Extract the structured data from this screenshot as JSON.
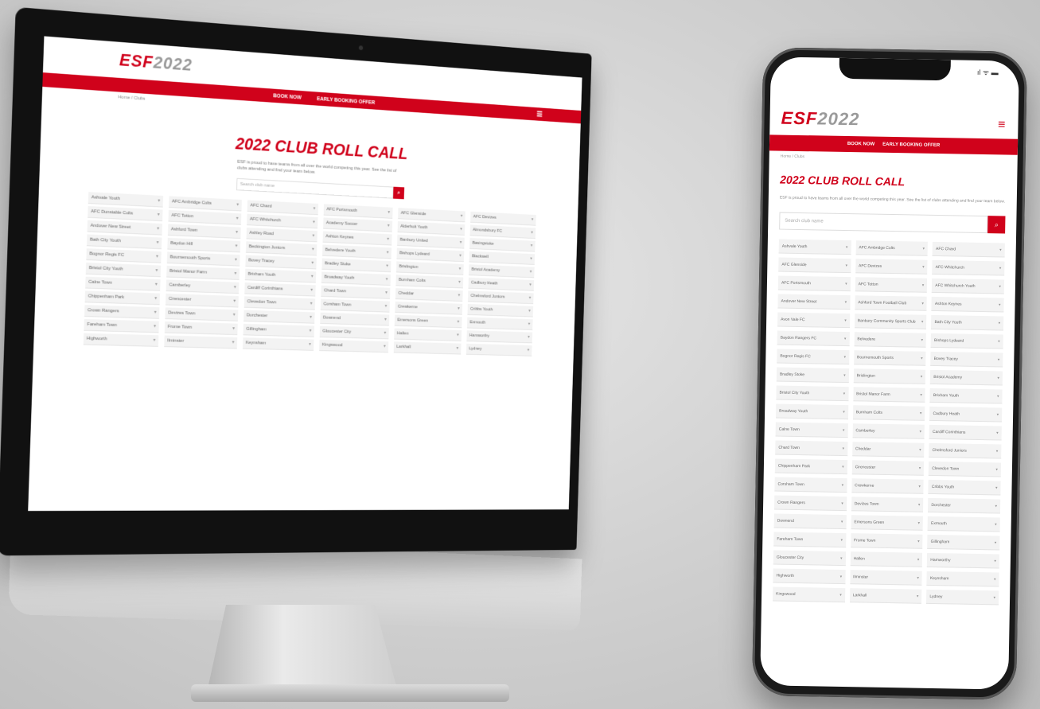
{
  "site": {
    "logo_left": "ESF",
    "logo_right": "2022",
    "nav": [
      "BOOK NOW",
      "EARLY BOOKING OFFER"
    ],
    "breadcrumb": "Home / Clubs",
    "title": "2022 CLUB ROLL CALL",
    "intro": "ESF is proud to have teams from all over the world competing this year. See the list of clubs attending and find your team below.",
    "search_placeholder": "Search club name",
    "menu_icon": "hamburger-icon",
    "search_icon": "search-icon"
  },
  "status_bar": "ıl ᯤ ▬",
  "clubs": [
    "Ashvale Youth",
    "AFC Ambridge Colts",
    "AFC Chard",
    "AFC Portsmouth",
    "AFC Glenside",
    "AFC Devizes",
    "AFC Dunstable Colts",
    "AFC Totton",
    "AFC Whitchurch",
    "Academy Soccer",
    "Alderholt Youth",
    "Almondsbury FC",
    "Andover New Street",
    "Ashford Town",
    "Ashley Road",
    "Ashton Keynes",
    "Banbury United",
    "Basingstoke",
    "Bath City Youth",
    "Baydon Hill",
    "Beckington Juniors",
    "Belvedere Youth",
    "Bishops Lydeard",
    "Blackwell",
    "Bognor Regis FC",
    "Bournemouth Sports",
    "Bovey Tracey",
    "Bradley Stoke",
    "Brislington",
    "Bristol Academy",
    "Bristol City Youth",
    "Bristol Manor Farm",
    "Brixham Youth",
    "Broadway Youth",
    "Burnham Colts",
    "Cadbury Heath",
    "Calne Town",
    "Camberley",
    "Cardiff Corinthians",
    "Chard Town",
    "Cheddar",
    "Chelmsford Juniors",
    "Chippenham Park",
    "Cirencester",
    "Clevedon Town",
    "Corsham Town",
    "Crewkerne",
    "Cribbs Youth",
    "Crown Rangers",
    "Devizes Town",
    "Dorchester",
    "Downend",
    "Emersons Green",
    "Exmouth",
    "Fareham Town",
    "Frome Town",
    "Gillingham",
    "Gloucester City",
    "Hallen",
    "Hamworthy",
    "Highworth",
    "Ilminster",
    "Keynsham",
    "Kingswood",
    "Larkhall",
    "Lydney"
  ],
  "phone_clubs": [
    "Ashvale Youth",
    "AFC Ambridge Colts",
    "AFC Chard",
    "AFC Glenside",
    "AFC Devizes",
    "AFC Whitchurch",
    "AFC Portsmouth",
    "AFC Totton",
    "AFC Whitchurch Youth",
    "Andover New Street",
    "Ashford Town Football Club",
    "Ashton Keynes",
    "Avon Vale FC",
    "Banbury Community Sports Club",
    "Bath City Youth",
    "Baydon Rangers FC",
    "Belvedere",
    "Bishops Lydeard",
    "Bognor Regis FC",
    "Bournemouth Sports",
    "Bovey Tracey",
    "Bradley Stoke",
    "Brislington",
    "Bristol Academy",
    "Bristol City Youth",
    "Bristol Manor Farm",
    "Brixham Youth",
    "Broadway Youth",
    "Burnham Colts",
    "Cadbury Heath",
    "Calne Town",
    "Camberley",
    "Cardiff Corinthians",
    "Chard Town",
    "Cheddar",
    "Chelmsford Juniors",
    "Chippenham Park",
    "Cirencester",
    "Clevedon Town",
    "Corsham Town",
    "Crewkerne",
    "Cribbs Youth",
    "Crown Rangers",
    "Devizes Town",
    "Dorchester",
    "Downend",
    "Emersons Green",
    "Exmouth",
    "Fareham Town",
    "Frome Town",
    "Gillingham",
    "Gloucester City",
    "Hallen",
    "Hamworthy",
    "Highworth",
    "Ilminster",
    "Keynsham",
    "Kingswood",
    "Larkhall",
    "Lydney"
  ]
}
